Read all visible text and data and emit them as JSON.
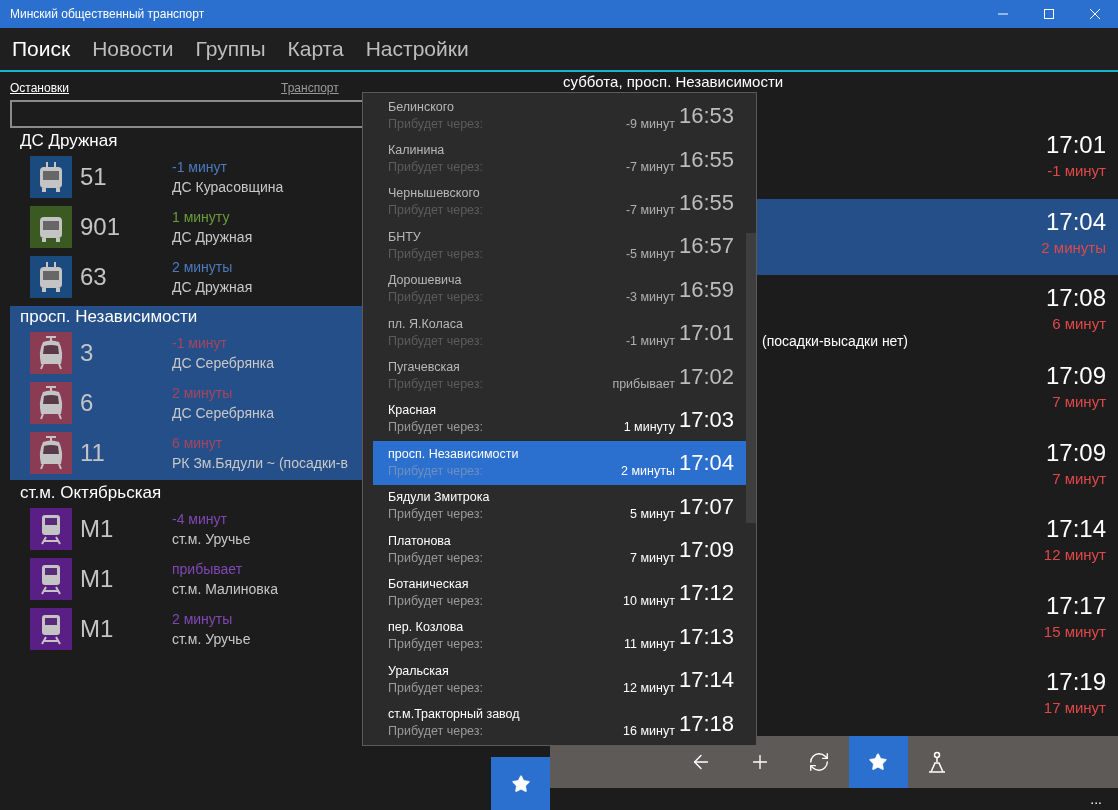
{
  "window": {
    "title": "Минский общественный транспорт"
  },
  "tabs": [
    {
      "label": "Поиск",
      "selected": true
    },
    {
      "label": "Новости",
      "selected": false
    },
    {
      "label": "Группы",
      "selected": false
    },
    {
      "label": "Карта",
      "selected": false
    },
    {
      "label": "Настройки",
      "selected": false
    }
  ],
  "search": {
    "modes": [
      {
        "label": "Остановки",
        "selected": true
      },
      {
        "label": "Транспорт",
        "selected": false
      }
    ]
  },
  "stops": [
    {
      "name": "ДС Дружная",
      "selected": false,
      "routes": [
        {
          "kind": "trolleybus",
          "color": "#1b4a7e",
          "number": "51",
          "arrival": "-1 минут",
          "destination": "ДС Курасовщина"
        },
        {
          "kind": "bus",
          "color": "#3b5a22",
          "number": "901",
          "arrival": "1 минуту",
          "destination": "ДС Дружная"
        },
        {
          "kind": "trolleybus",
          "color": "#1b4a7e",
          "number": "63",
          "arrival": "2 минуты",
          "destination": "ДС Дружная"
        }
      ]
    },
    {
      "name": "просп. Независимости",
      "selected": true,
      "routes": [
        {
          "kind": "tram",
          "color": "#8a3c55",
          "number": "3",
          "arrival": "-1 минут",
          "destination": "ДС Серебрянка"
        },
        {
          "kind": "tram",
          "color": "#8a3c55",
          "number": "6",
          "arrival": "2 минуты",
          "destination": "ДС Серебрянка"
        },
        {
          "kind": "tram",
          "color": "#8a3c55",
          "number": "11",
          "arrival": "6 минут",
          "destination": "РК Зм.Бядули ~ (посадки-в"
        }
      ]
    },
    {
      "name": "ст.м. Октябрьская",
      "selected": false,
      "routes": [
        {
          "kind": "metro",
          "color": "#5a1f84",
          "number": "М1",
          "arrival": "-4 минут",
          "destination": "ст.м. Уручье"
        },
        {
          "kind": "metro",
          "color": "#5a1f84",
          "number": "М1",
          "arrival": "прибывает",
          "destination": "ст.м. Малиновка"
        },
        {
          "kind": "metro",
          "color": "#5a1f84",
          "number": "М1",
          "arrival": "2 минуты",
          "destination": "ст.м. Уручье"
        }
      ]
    }
  ],
  "schedule": {
    "title": "суббота, просп. Независимости",
    "rows": [
      {
        "time": "17:01",
        "arrival": "-1 минут",
        "selected": false
      },
      {
        "time": "17:04",
        "arrival": "2 минуты",
        "selected": true
      },
      {
        "time": "17:08",
        "arrival": "6 минут",
        "note": "(посадки-высадки нет)",
        "selected": false
      },
      {
        "time": "17:09",
        "arrival": "7 минут",
        "selected": false
      },
      {
        "time": "17:09",
        "arrival": "7 минут",
        "selected": false
      },
      {
        "time": "17:14",
        "arrival": "12 минут",
        "selected": false
      },
      {
        "time": "17:17",
        "arrival": "15 минут",
        "selected": false
      },
      {
        "time": "17:19",
        "arrival": "17 минут",
        "selected": false
      }
    ]
  },
  "route_stops": [
    {
      "name": "Белинского",
      "caption": "Прибудет через:",
      "arrival": "-9 минут",
      "time": "16:53",
      "passed": true,
      "selected": false
    },
    {
      "name": "Калинина",
      "caption": "Прибудет через:",
      "arrival": "-7 минут",
      "time": "16:55",
      "passed": true,
      "selected": false
    },
    {
      "name": "Чернышевского",
      "caption": "Прибудет через:",
      "arrival": "-7 минут",
      "time": "16:55",
      "passed": true,
      "selected": false
    },
    {
      "name": "БНТУ",
      "caption": "Прибудет через:",
      "arrival": "-5 минут",
      "time": "16:57",
      "passed": true,
      "selected": false
    },
    {
      "name": "Дорошевича",
      "caption": "Прибудет через:",
      "arrival": "-3 минут",
      "time": "16:59",
      "passed": true,
      "selected": false
    },
    {
      "name": "пл. Я.Коласа",
      "caption": "Прибудет через:",
      "arrival": "-1 минут",
      "time": "17:01",
      "passed": true,
      "selected": false
    },
    {
      "name": "Пугачевская",
      "caption": "Прибудет через:",
      "arrival": "прибывает",
      "time": "17:02",
      "passed": true,
      "selected": false
    },
    {
      "name": "Красная",
      "caption": "Прибудет через:",
      "arrival": "1 минуту",
      "time": "17:03",
      "passed": false,
      "selected": false
    },
    {
      "name": "просп. Независимости",
      "caption": "Прибудет через:",
      "arrival": "2 минуты",
      "time": "17:04",
      "passed": false,
      "selected": true
    },
    {
      "name": "Бядули Змитрока",
      "caption": "Прибудет через:",
      "arrival": "5 минут",
      "time": "17:07",
      "passed": false,
      "selected": false
    },
    {
      "name": "Платонова",
      "caption": "Прибудет через:",
      "arrival": "7 минут",
      "time": "17:09",
      "passed": false,
      "selected": false
    },
    {
      "name": "Ботаническая",
      "caption": "Прибудет через:",
      "arrival": "10 минут",
      "time": "17:12",
      "passed": false,
      "selected": false
    },
    {
      "name": "пер. Козлова",
      "caption": "Прибудет через:",
      "arrival": "11 минут",
      "time": "17:13",
      "passed": false,
      "selected": false
    },
    {
      "name": "Уральская",
      "caption": "Прибудет через:",
      "arrival": "12 минут",
      "time": "17:14",
      "passed": false,
      "selected": false
    },
    {
      "name": "ст.м.Тракторный завод",
      "caption": "Прибудет через:",
      "arrival": "16 минут",
      "time": "17:18",
      "passed": false,
      "selected": false
    }
  ],
  "command_bar": {
    "buttons": [
      {
        "kind": "back",
        "selected": false
      },
      {
        "kind": "add",
        "selected": false
      },
      {
        "kind": "refresh",
        "selected": false
      },
      {
        "kind": "favorite",
        "selected": true
      },
      {
        "kind": "walk",
        "selected": false
      }
    ],
    "more": "..."
  }
}
